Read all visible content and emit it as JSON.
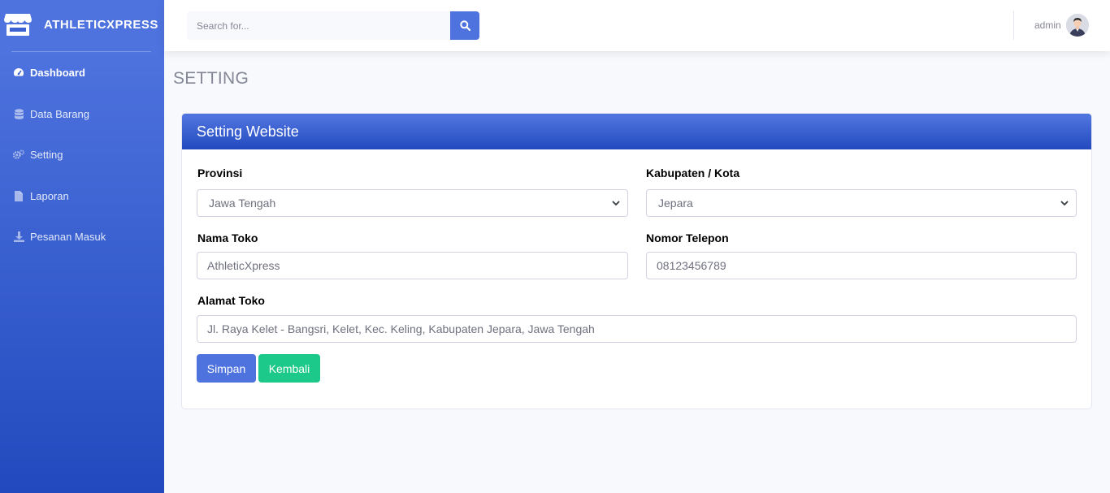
{
  "brand": {
    "name": "ATHLETICXPRESS",
    "icon": "store-icon"
  },
  "sidebar": {
    "items": [
      {
        "label": "Dashboard",
        "icon": "tachometer-icon",
        "active": true
      },
      {
        "label": "Data Barang",
        "icon": "database-icon",
        "active": false
      },
      {
        "label": "Setting",
        "icon": "cogs-icon",
        "active": false
      },
      {
        "label": "Laporan",
        "icon": "file-icon",
        "active": false
      },
      {
        "label": "Pesanan Masuk",
        "icon": "download-icon",
        "active": false
      }
    ]
  },
  "topbar": {
    "search_placeholder": "Search for...",
    "user_name": "admin"
  },
  "page": {
    "title": "SETTING"
  },
  "card": {
    "title": "Setting Website",
    "fields": {
      "provinsi": {
        "label": "Provinsi",
        "value": "Jawa Tengah"
      },
      "kabupaten": {
        "label": "Kabupaten / Kota",
        "value": "Jepara"
      },
      "nama_toko": {
        "label": "Nama Toko",
        "value": "AthleticXpress"
      },
      "nomor_telepon": {
        "label": "Nomor Telepon",
        "value": "08123456789"
      },
      "alamat_toko": {
        "label": "Alamat Toko",
        "value": "Jl. Raya Kelet - Bangsri, Kelet, Kec. Keling, Kabupaten Jepara, Jawa Tengah"
      }
    },
    "buttons": {
      "save": "Simpan",
      "back": "Kembali"
    }
  },
  "colors": {
    "primary": "#4e73df",
    "primary_dark": "#224abe",
    "success": "#1cc88a"
  }
}
